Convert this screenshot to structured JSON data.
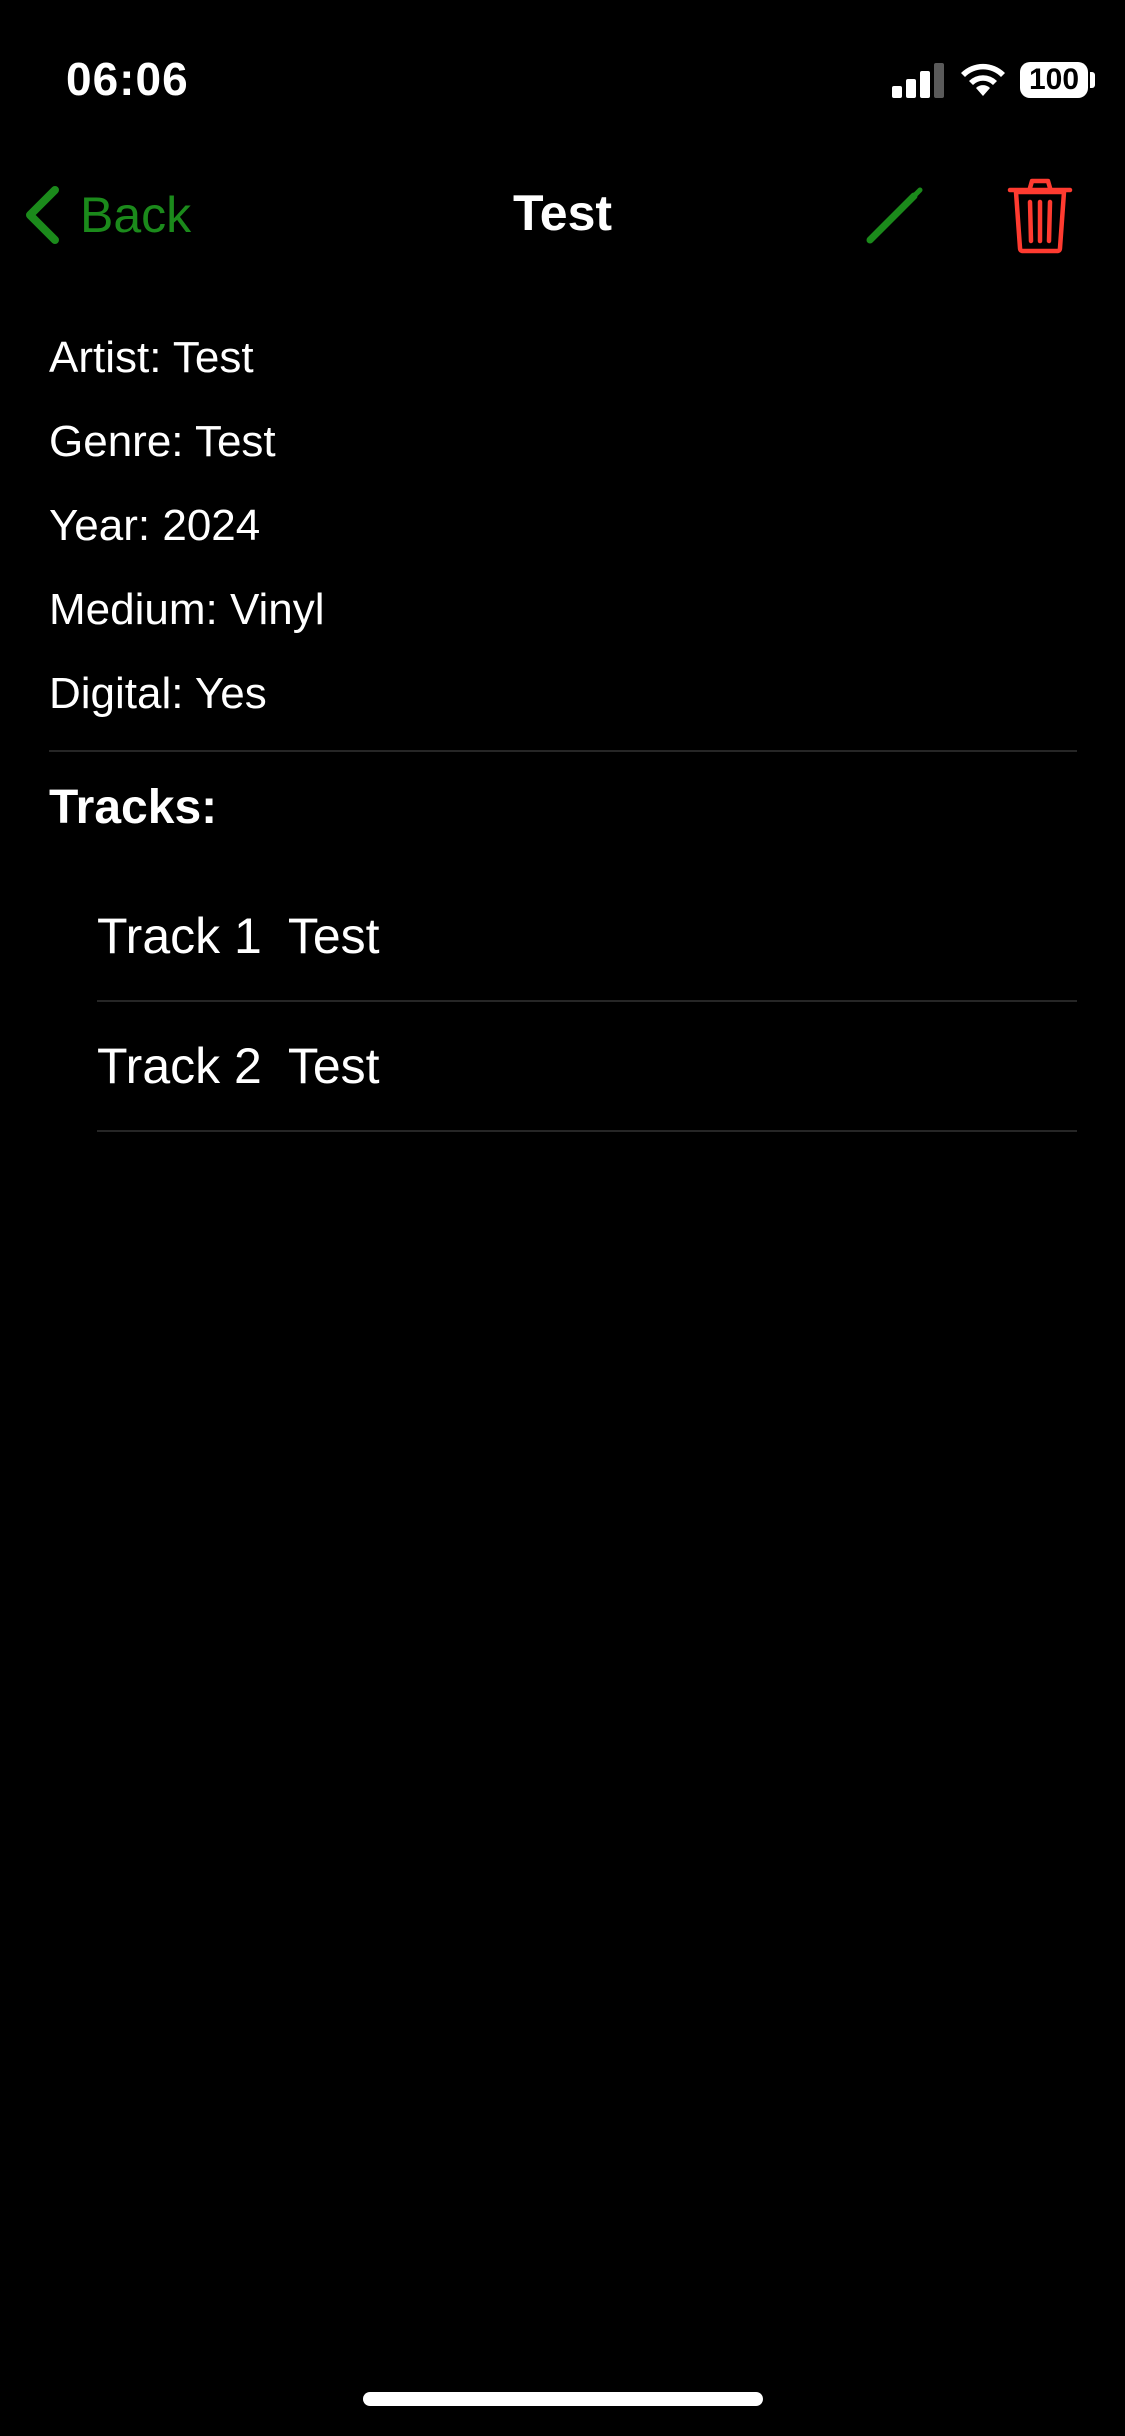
{
  "status_bar": {
    "time": "06:06",
    "battery": "100"
  },
  "nav": {
    "back_label": "Back",
    "title": "Test",
    "icons": {
      "back": "chevron-left-icon",
      "edit": "pencil-icon",
      "delete": "trash-icon"
    },
    "accent_color": "#1b8a1b",
    "delete_color": "#ff3b30"
  },
  "details": [
    {
      "text": "Artist: Test"
    },
    {
      "text": "Genre: Test"
    },
    {
      "text": "Year: 2024"
    },
    {
      "text": "Medium: Vinyl"
    },
    {
      "text": "Digital: Yes"
    }
  ],
  "tracks": {
    "heading": "Tracks:",
    "items": [
      {
        "number": "Track 1",
        "title": "Test"
      },
      {
        "number": "Track 2",
        "title": "Test"
      }
    ]
  }
}
